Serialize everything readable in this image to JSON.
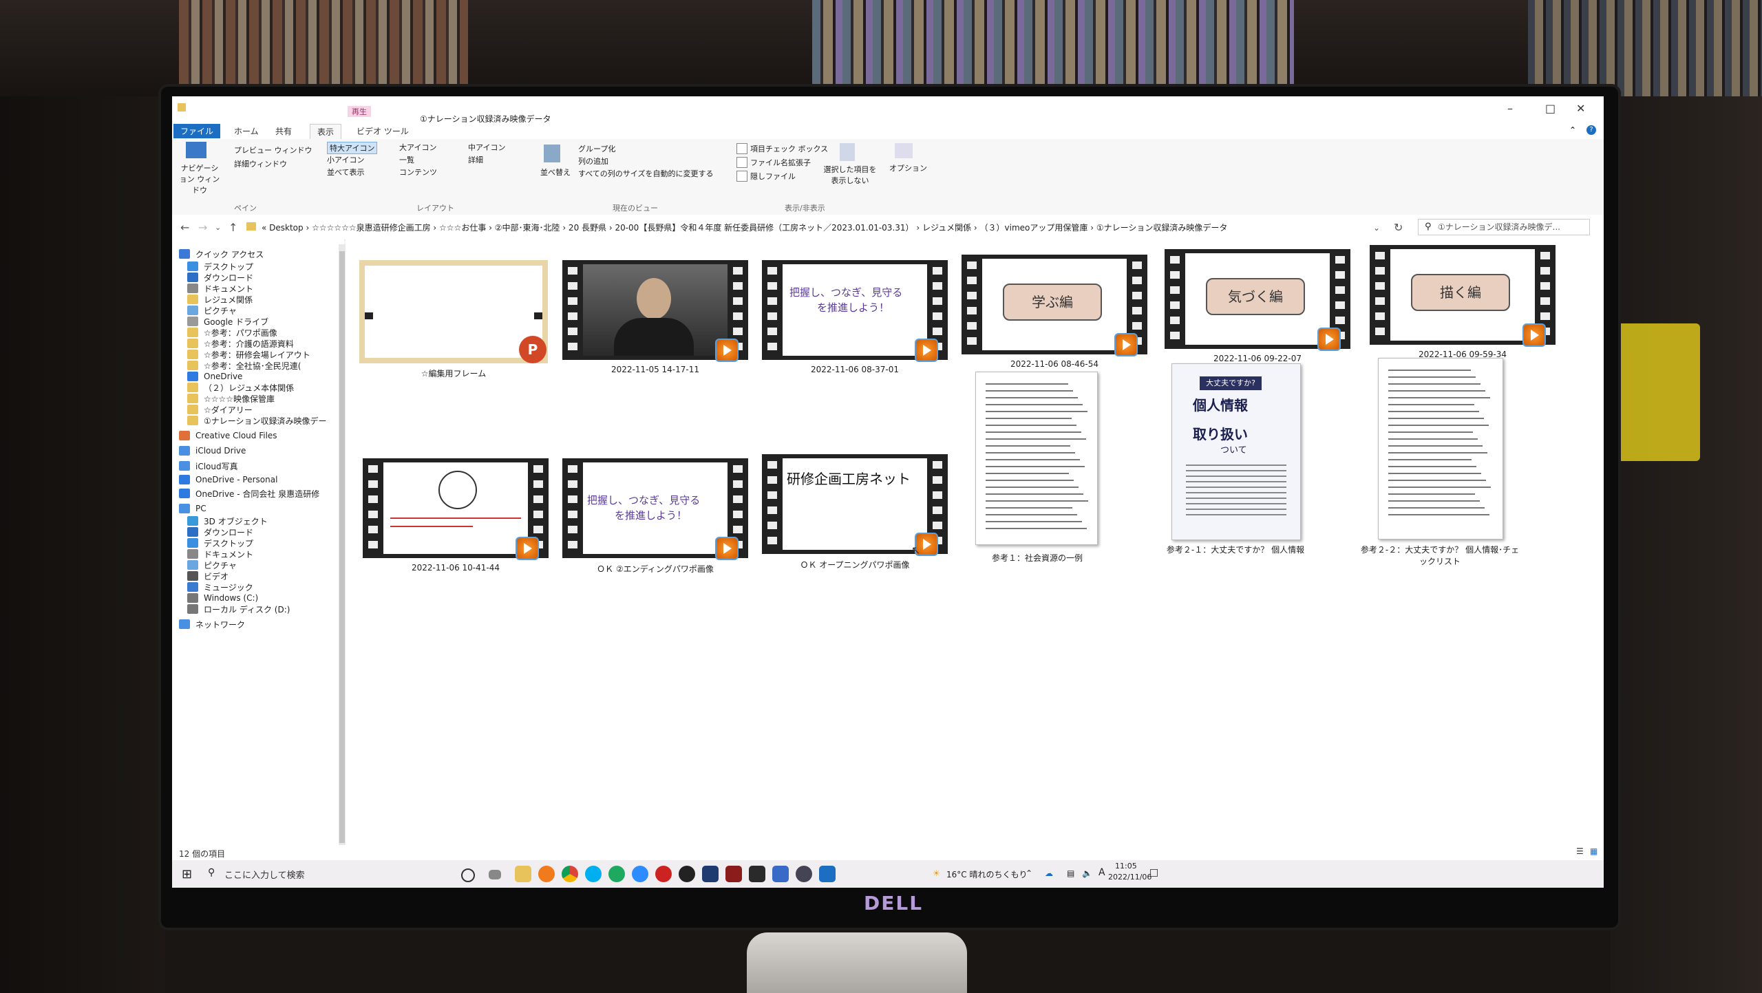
{
  "window": {
    "context_tab": "再生",
    "title_path": "①ナレーション収録済み映像データ",
    "tabs": [
      "ファイル",
      "ホーム",
      "共有",
      "表示",
      "ビデオ ツール"
    ]
  },
  "ribbon": {
    "pane_buttons": [
      "ナビゲーション ウィンドウ",
      "プレビュー ウィンドウ",
      "詳細ウィンドウ"
    ],
    "layout_options": [
      "特大アイコン",
      "大アイコン",
      "中アイコン",
      "小アイコン",
      "一覧",
      "詳細",
      "並べて表示",
      "コンテンツ"
    ],
    "current_view": [
      "並べ替え",
      "グループ化",
      "列の追加",
      "すべての列のサイズを自動的に変更する"
    ],
    "show_hide": [
      "項目チェック ボックス",
      "ファイル名拡張子",
      "隠しファイル"
    ],
    "hide_selected": "選択した項目を表示しない",
    "options": "オプション",
    "group_labels": [
      "ペイン",
      "レイアウト",
      "現在のビュー",
      "表示/非表示"
    ]
  },
  "address": {
    "crumbs": "« Desktop › ☆☆☆☆☆☆泉惠造研修企画工房 › ☆☆☆お仕事 › ②中部･東海･北陸 › 20 長野県 › 20-00【長野県】令和４年度 新任委員研修（工房ネット／2023.01.01-03.31） › レジュメ関係 › （３）vimeoアップ用保管庫 › ①ナレーション収録済み映像データ",
    "search_placeholder": "①ナレーション収録済み映像デ..."
  },
  "nav": [
    {
      "label": "クイック アクセス",
      "color": "#3b78d8"
    },
    {
      "label": "デスクトップ",
      "color": "#3b8fe0"
    },
    {
      "label": "ダウンロード",
      "color": "#2d6fc4"
    },
    {
      "label": "ドキュメント",
      "color": "#888"
    },
    {
      "label": "レジュメ関係",
      "color": "#e8c25a"
    },
    {
      "label": "ピクチャ",
      "color": "#6aa6e0"
    },
    {
      "label": "Google ドライブ",
      "color": "#999"
    },
    {
      "label": "☆参考：パワポ画像",
      "color": "#e8c25a"
    },
    {
      "label": "☆参考：介護の語源資料",
      "color": "#e8c25a"
    },
    {
      "label": "☆参考：研修会場レイアウト",
      "color": "#e8c25a"
    },
    {
      "label": "☆参考：全社協･全民児連(",
      "color": "#e8c25a"
    },
    {
      "label": "OneDrive",
      "color": "#2d7be0"
    },
    {
      "label": "（２）レジュメ本体関係",
      "color": "#e8c25a"
    },
    {
      "label": "☆☆☆☆映像保管庫",
      "color": "#e8c25a"
    },
    {
      "label": "☆ダイアリー",
      "color": "#e8c25a"
    },
    {
      "label": "①ナレーション収録済み映像デー",
      "color": "#e8c25a"
    },
    {
      "label": "Creative Cloud Files",
      "color": "#e0703a"
    },
    {
      "label": "iCloud Drive",
      "color": "#4a90e2"
    },
    {
      "label": "iCloud写真",
      "color": "#4a90e2"
    },
    {
      "label": "OneDrive - Personal",
      "color": "#2d7be0"
    },
    {
      "label": "OneDrive - 合同会社 泉惠造研修",
      "color": "#2d7be0"
    },
    {
      "label": "PC",
      "color": "#4a90e2"
    },
    {
      "label": "3D オブジェクト",
      "color": "#3a9ad9"
    },
    {
      "label": "ダウンロード",
      "color": "#2d6fc4"
    },
    {
      "label": "デスクトップ",
      "color": "#3b8fe0"
    },
    {
      "label": "ドキュメント",
      "color": "#888"
    },
    {
      "label": "ピクチャ",
      "color": "#6aa6e0"
    },
    {
      "label": "ビデオ",
      "color": "#555"
    },
    {
      "label": "ミュージック",
      "color": "#3a7ad0"
    },
    {
      "label": "Windows (C:)",
      "color": "#777"
    },
    {
      "label": "ローカル ディスク (D:)",
      "color": "#777"
    },
    {
      "label": "ネットワーク",
      "color": "#4a90e2"
    }
  ],
  "files": {
    "captions": [
      "☆編集用フレーム",
      "2022-11-05 14-17-11",
      "2022-11-06 08-37-01",
      "2022-11-06 08-46-54",
      "2022-11-06 09-22-07",
      "2022-11-06 09-59-34",
      "2022-11-06 10-41-44",
      "ＯＫ ②エンディングパワポ画像",
      "ＯＫ オープニングパワポ画像",
      "参考１：社会資源の一例",
      "参考２-１：大丈夫ですか？ 個人情報",
      "参考２-２：大丈夫ですか？ 個人情報･チェックリスト"
    ],
    "slide_texts": {
      "slogan": "把握し、つなぎ、見守る",
      "slogan2": "を推進しよう！",
      "manabu": "学ぶ編",
      "kizuku": "気づく編",
      "egaku": "描く編",
      "kenshu": "研修企画工房ネット",
      "pamphlet_top": "大丈夫ですか?",
      "pamphlet_1": "個人情報",
      "pamphlet_2": "取り扱い",
      "pamphlet_3": "ついて"
    }
  },
  "status": {
    "count": "12 個の項目"
  },
  "taskbar": {
    "search_placeholder": "ここに入力して検索",
    "weather": "16°C 晴れのちくもり",
    "time": "11:05",
    "date": "2022/11/06",
    "ime": "A"
  }
}
